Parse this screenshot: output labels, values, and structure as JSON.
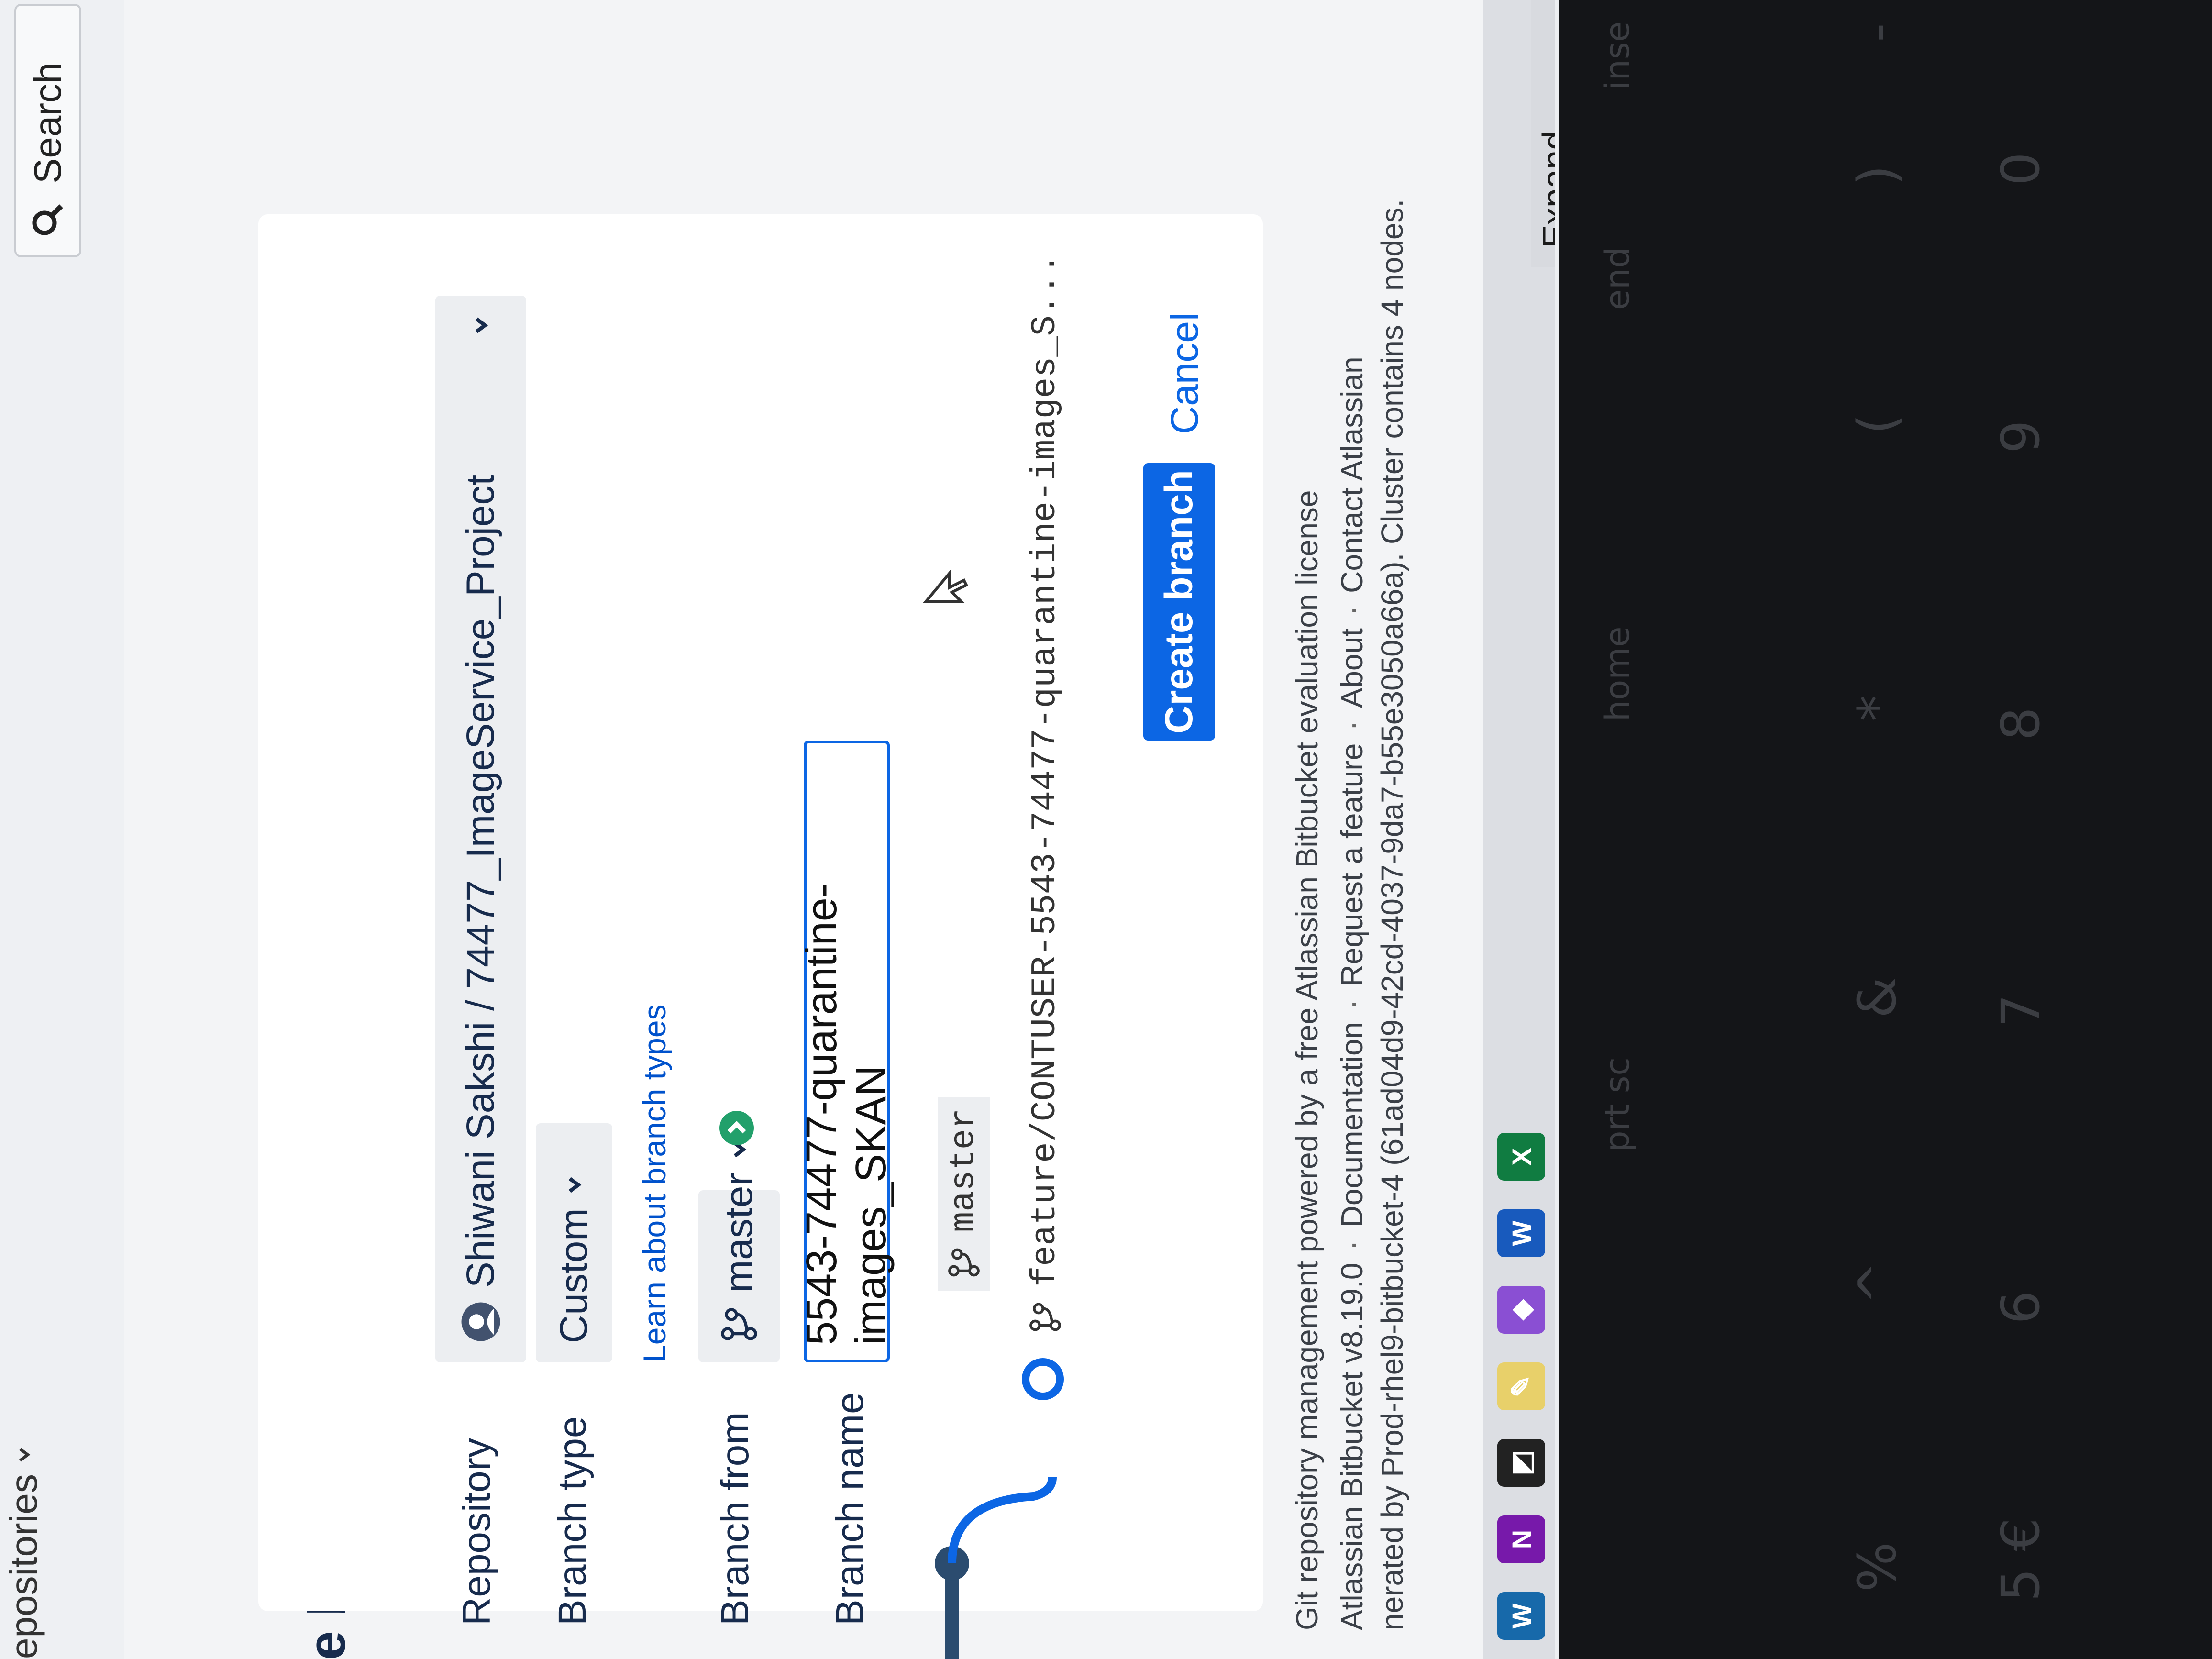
{
  "nav": {
    "repositories_label": "epositories"
  },
  "search": {
    "label": "Search",
    "icon": "search-icon"
  },
  "page": {
    "title": "ate branch"
  },
  "form": {
    "repository_label": "Repository",
    "repository_value": "Shiwani Sakshi / 74477_ImageService_Project",
    "branch_type_label": "Branch type",
    "branch_type_value": "Custom",
    "learn_link": "Learn about branch types",
    "branch_from_label": "Branch from",
    "branch_from_value": "master",
    "branch_name_label": "Branch name",
    "branch_name_value": "5543-74477-quarantine-images_SKAN"
  },
  "preview": {
    "source_branch": "master",
    "new_branch": "feature/CONTUSER-5543-74477-quarantine-images_S..."
  },
  "actions": {
    "create": "Create branch",
    "cancel": "Cancel"
  },
  "footer": {
    "license": "Git repository management powered by a free Atlassian Bitbucket evaluation license",
    "links": [
      "Atlassian Bitbucket v8.19.0",
      "Documentation",
      "Request a feature",
      "About",
      "Contact Atlassian"
    ],
    "node_info": "nerated by Prod-rhel9-bitbucket-4 (61ad04d9-42cd-4037-9da7-b55e3050a66a). Cluster contains 4 nodes."
  },
  "taskbar": {
    "expand_label": "Expand window to",
    "apps": [
      "onenote-icon",
      "sticky-notes-icon",
      "paint-icon",
      "visual-studio-icon",
      "word-icon",
      "excel-icon"
    ]
  },
  "keyboard": {
    "function_row": [
      "prt sc",
      "home",
      "end",
      "inse"
    ],
    "number_row": [
      "5 €",
      "6",
      "7",
      "8",
      "9",
      "0"
    ],
    "symbol_row": [
      "%",
      "^",
      "&",
      "*",
      "(",
      ")",
      "-"
    ]
  },
  "colors": {
    "accent": "#0c66e4",
    "success": "#22a06b",
    "text": "#172b4d"
  }
}
